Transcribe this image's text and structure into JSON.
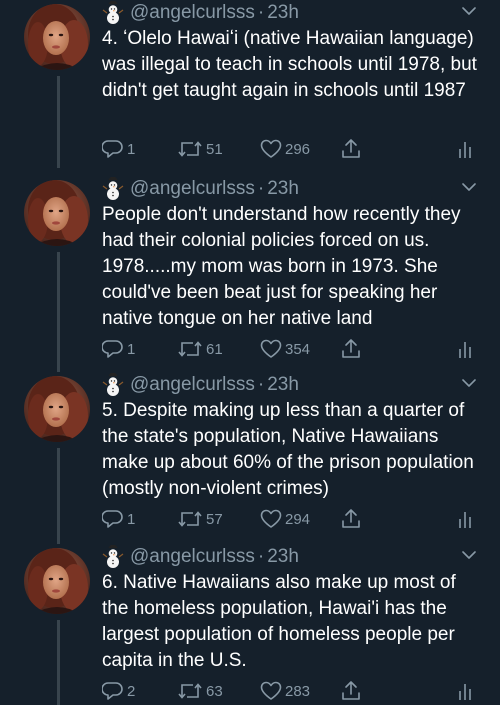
{
  "colors": {
    "background": "#15202b",
    "text": "#ffffff",
    "muted": "#8899a6",
    "thread_line": "#38444d"
  },
  "tweets": [
    {
      "handle": "@angelcurlsss",
      "dot": "·",
      "time": "23h",
      "text": "4. ʻOlelo Hawaiʻi (native Hawaiian language) was illegal to teach in schools until 1978, but didn't get taught again in schools until 1987",
      "replies": "1",
      "retweets": "51",
      "likes": "296"
    },
    {
      "handle": "@angelcurlsss",
      "dot": "·",
      "time": "23h",
      "text": "People don't understand how recently they had their colonial policies forced on us. 1978.....my mom was born in 1973. She could've been beat just for speaking her native tongue on her native land",
      "replies": "1",
      "retweets": "61",
      "likes": "354"
    },
    {
      "handle": "@angelcurlsss",
      "dot": "·",
      "time": "23h",
      "text": "5. Despite making up less than a quarter of the state's population, Native Hawaiians make up about 60% of the prison population (mostly non-violent crimes)",
      "replies": "1",
      "retweets": "57",
      "likes": "294"
    },
    {
      "handle": "@angelcurlsss",
      "dot": "·",
      "time": "23h",
      "text": "6. Native Hawaiians also make up most of the homeless population, Hawai'i has the largest population of homeless people per capita in the U.S.",
      "replies": "2",
      "retweets": "63",
      "likes": "283"
    }
  ],
  "icons": {
    "emoji": "snowman-icon",
    "menu": "chevron-down-icon",
    "reply": "reply-icon",
    "retweet": "retweet-icon",
    "like": "heart-icon",
    "share": "share-icon",
    "analytics": "analytics-icon"
  }
}
